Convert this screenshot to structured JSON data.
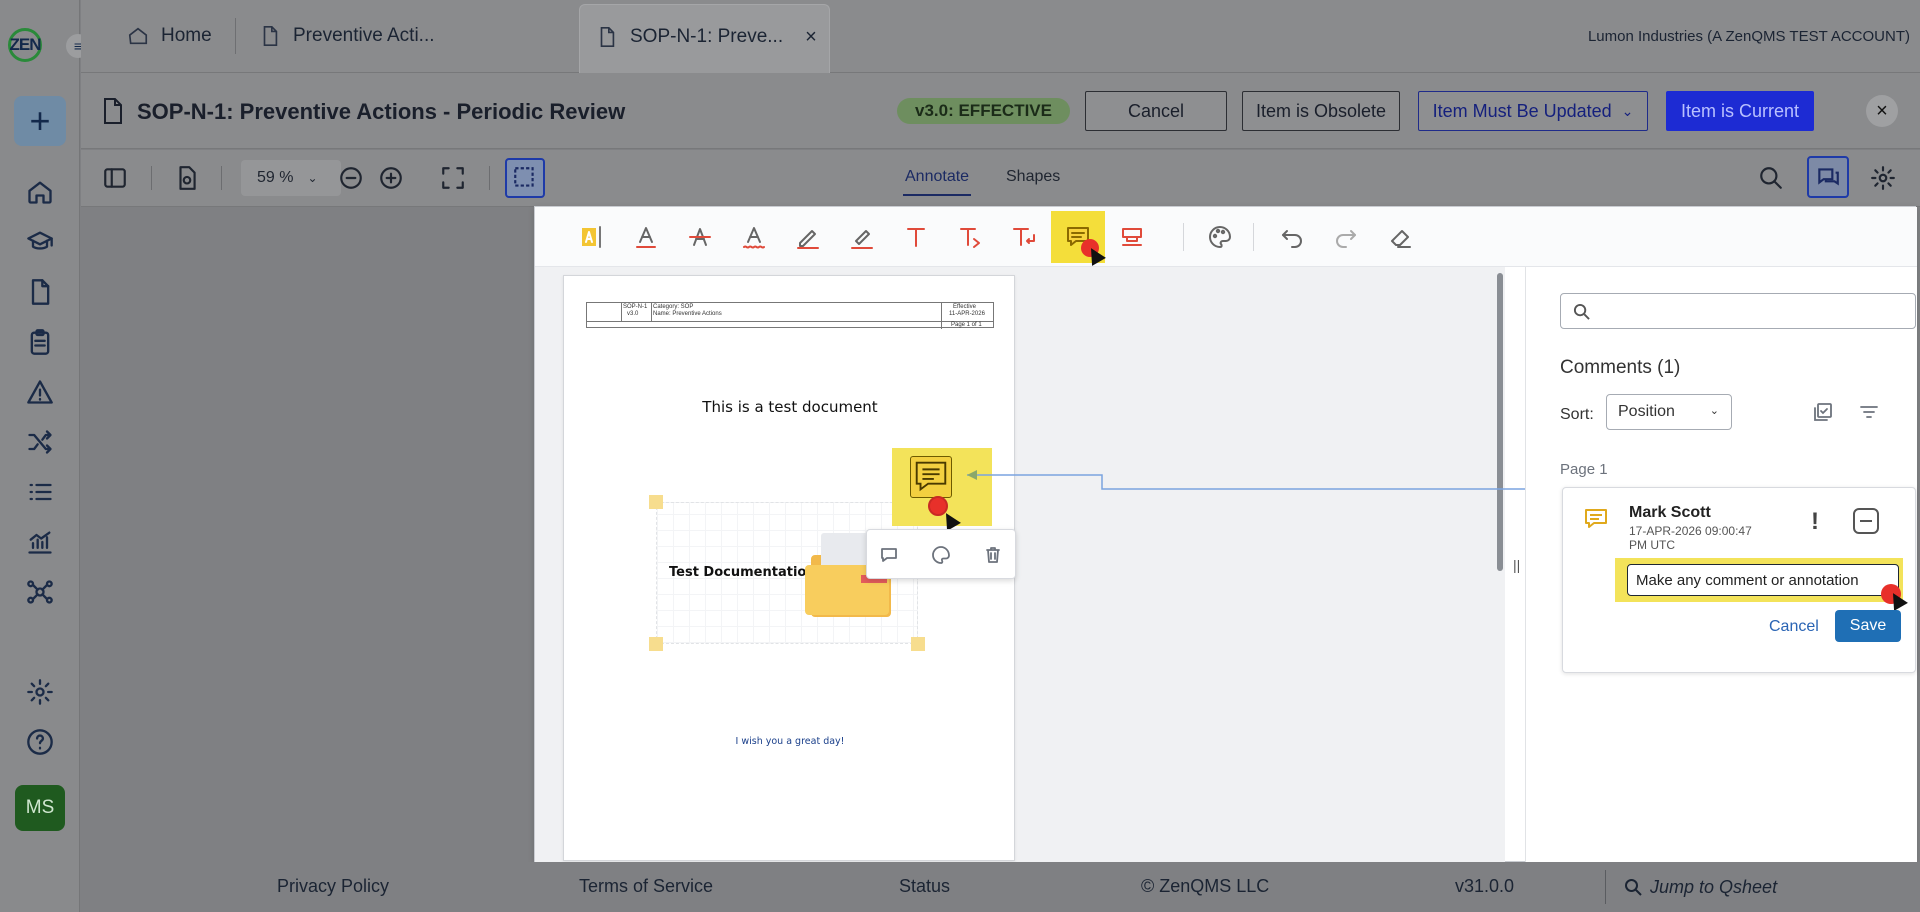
{
  "app": {
    "logo_text": "ZEN",
    "account": "Lumon Industries (A ZenQMS TEST ACCOUNT)",
    "user_initials": "MS"
  },
  "tabs": [
    {
      "label": "Home",
      "icon": "home-icon"
    },
    {
      "label": "Preventive Acti...",
      "icon": "document-icon"
    },
    {
      "label": "SOP-N-1: Preve...",
      "icon": "document-icon",
      "active": true,
      "close": "×"
    }
  ],
  "header": {
    "title": "SOP-N-1: Preventive Actions - Periodic Review",
    "status": "v3.0: EFFECTIVE",
    "cancel": "Cancel",
    "obsolete": "Item is Obsolete",
    "must_update": "Item Must Be Updated",
    "current": "Item is Current",
    "close": "×"
  },
  "viewer": {
    "zoom": "59 %",
    "modes": [
      "Annotate",
      "Shapes"
    ],
    "active_mode": "Annotate"
  },
  "document": {
    "header_cells": {
      "doc_id": "SOP-N-1",
      "version": "v3.0",
      "category": "Category: SOP",
      "name": "Name: Preventive Actions",
      "status": "Effective",
      "date": "11-APR-2026",
      "page": "Page 1 of 1"
    },
    "heading": "This is a test document",
    "image_label": "Test Documentation",
    "footer_text": "I wish you a great day!"
  },
  "comments": {
    "heading": "Comments (1)",
    "sort_label": "Sort:",
    "sort_value": "Position",
    "page_group": "Page 1",
    "search_placeholder": "",
    "items": [
      {
        "author": "Mark Scott",
        "date": "17-APR-2026 09:00:47 PM UTC",
        "priority": "!",
        "text": "Make any comment or annotation",
        "cancel": "Cancel",
        "save": "Save"
      }
    ]
  },
  "footer": {
    "privacy": "Privacy Policy",
    "terms": "Terms of Service",
    "status": "Status",
    "copyright": "© ZenQMS LLC",
    "version": "v31.0.0",
    "jump_placeholder": "Jump to Qsheet"
  },
  "colors": {
    "highlight": "#f3e35a",
    "primary": "#1d2bd3",
    "save": "#1f6fb5",
    "annotation_red": "#e8302a"
  }
}
